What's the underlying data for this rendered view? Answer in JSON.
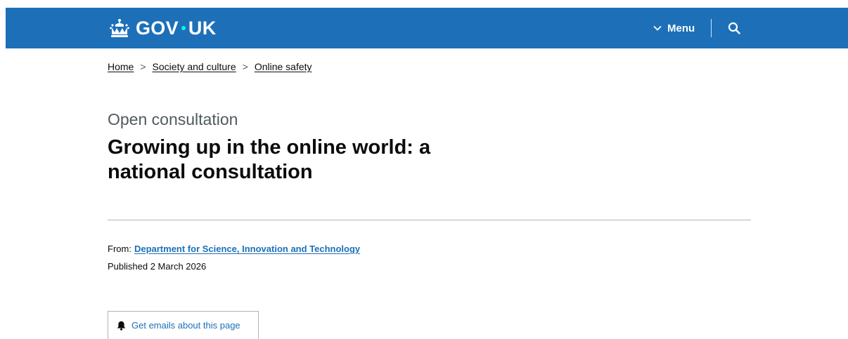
{
  "header": {
    "logo_text_left": "GOV",
    "logo_text_right": "UK",
    "menu_label": "Menu",
    "brand_color": "#1d70b8",
    "logo_dot_color": "#00ffe0",
    "icons": [
      "crown-icon",
      "chevron-down-icon",
      "search-icon"
    ]
  },
  "breadcrumb": {
    "items": [
      {
        "label": "Home"
      },
      {
        "label": "Society and culture"
      },
      {
        "label": "Online safety"
      }
    ],
    "separator": ">"
  },
  "main": {
    "caption": "Open consultation",
    "title": "Growing up in the online world: a national consultation",
    "from_label": "From:",
    "organisation": "Department for Science, Innovation and Technology",
    "published": "Published 2 March 2026",
    "email_signup_label": "Get emails about this page",
    "link_color": "#1d70b8",
    "icons": [
      "bell-icon"
    ]
  }
}
